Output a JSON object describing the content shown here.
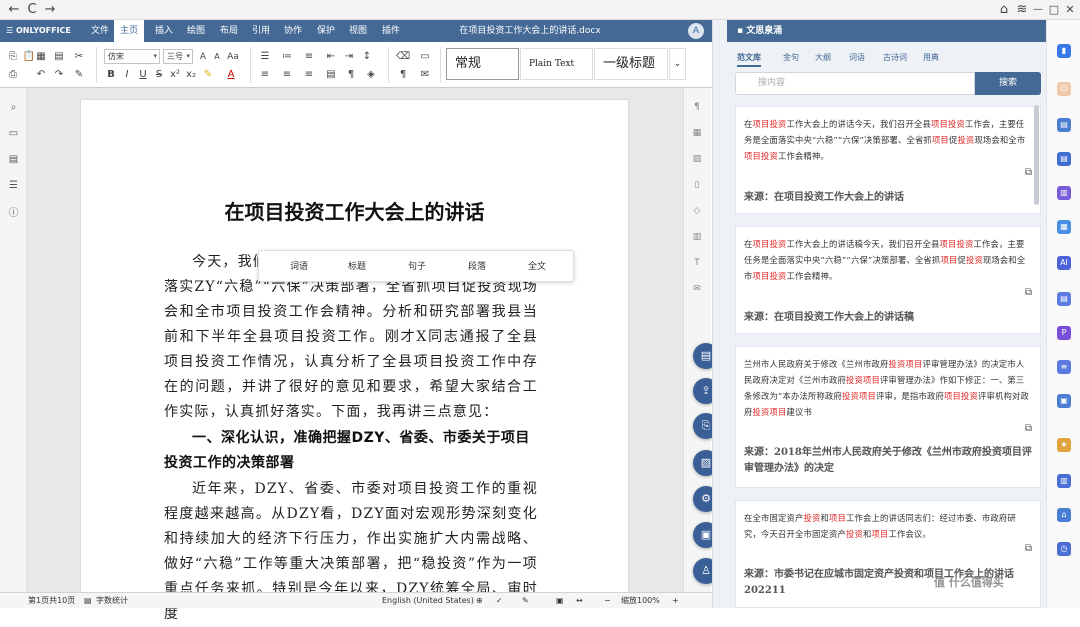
{
  "browser": {
    "back": "←",
    "forward": "→",
    "reload": "C",
    "home": "⌂",
    "wifi": "≋",
    "minimize": "—",
    "restore": "□",
    "close": "✕"
  },
  "app": {
    "logo": "ONLYOFFICE",
    "tabs": [
      "文件",
      "主页",
      "插入",
      "绘图",
      "布局",
      "引用",
      "协作",
      "保护",
      "视图",
      "插件"
    ],
    "active_tab": "主页",
    "doc_title": "在项目投资工作大会上的讲话.docx",
    "user_initial": "A"
  },
  "toolbar": {
    "font_name": "仿宋",
    "font_size": "三号",
    "styles": [
      "常规",
      "Plain Text",
      "一级标题"
    ]
  },
  "document": {
    "title": "在项目投资工作大会上的讲话",
    "p1_line1": "今天，我们召开全县项目投资工作会，主要任务是",
    "p1_rest": "落实ZY“六稳”“六保”决策部署，全省抓项目促投资现场会和全市项目投资工作会精神。分析和研究部署我县当前和下半年全县项目投资工作。刚才X同志通报了全县项目投资工作情况，认真分析了全县项目投资工作中存在的问题，并讲了很好的意见和要求，希望大家结合工作实际，认真抓好落实。下面，我再讲三点意见：",
    "heading1": "一、深化认识，准确把握DZY、省委、市委关于项目投资工作的决策部署",
    "p2": "近年来，DZY、省委、市委对项目投资工作的重视程度越来越高。从DZY看，DZY面对宏观形势深刻变化和持续加大的经济下行压力，作出实施扩大内需战略、做好“六稳”工作等重大决策部署，把“稳投资”作为一项重点任务来抓。特别是今年以来，DZY统筹全局、审时度"
  },
  "popup": [
    "词语",
    "标题",
    "句子",
    "段落",
    "全文"
  ],
  "statusbar": {
    "pages": "第1页共10页",
    "word_count": "字数统计",
    "language": "English (United States)",
    "zoom": "缩放100%"
  },
  "panel": {
    "title": "文思泉涌",
    "tabs": [
      "范文库",
      "金句",
      "大纲",
      "词语",
      "古诗词",
      "用典"
    ],
    "active_tab": "范文库",
    "search_placeholder": "搜内容",
    "search_button": "搜索",
    "cards": [
      {
        "snippet_html": "在<em>项目投资</em>工作大会上的讲话今天，我们召开全县<em>项目投资</em>工作会，主要任务是全面落实中央“六稳”“六保”决策部署、全省抓<em>项目</em>促<em>投资</em>现场会和全市<em>项目投资</em>工作会精神。",
        "source": "来源：在项目投资工作大会上的讲话"
      },
      {
        "snippet_html": "在<em>项目投资</em>工作大会上的讲话稿今天，我们召开全县<em>项目投资</em>工作会，主要任务是全面落实中央“六稳”“六保”决策部署、全省抓<em>项目</em>促<em>投资</em>现场会和全市<em>项目投资</em>工作会精神。",
        "source": "来源：在项目投资工作大会上的讲话稿"
      },
      {
        "snippet_html": "兰州市人民政府关于修改《兰州市政府<em>投资项目</em>评审管理办法》的决定市人民政府决定对《兰州市政府<em>投资项目</em>评审管理办法》作如下修正：一、第三条修改为“本办法所称政府<em>投资项目</em>评审，是指市政府<em>项目投资</em>评审机构对政府<em>投资项目</em>建议书",
        "source": "来源：2018年兰州市人民政府关于修改《兰州市政府投资项目评审管理办法》的决定"
      },
      {
        "snippet_html": "在全市固定资产<em>投资</em>和<em>项目</em>工作会上的讲话同志们：经过市委、市政府研究，今天召开全市固定资产<em>投资</em>和<em>项目</em>工作会议。",
        "source": "来源：市委书记在应城市固定资产投资和项目工作会上的讲话202211"
      }
    ]
  },
  "watermark": "值 什么值得买",
  "colors": {
    "brand": "#446995",
    "highlight": "#e02a2a",
    "fab": "#3a5f96"
  }
}
